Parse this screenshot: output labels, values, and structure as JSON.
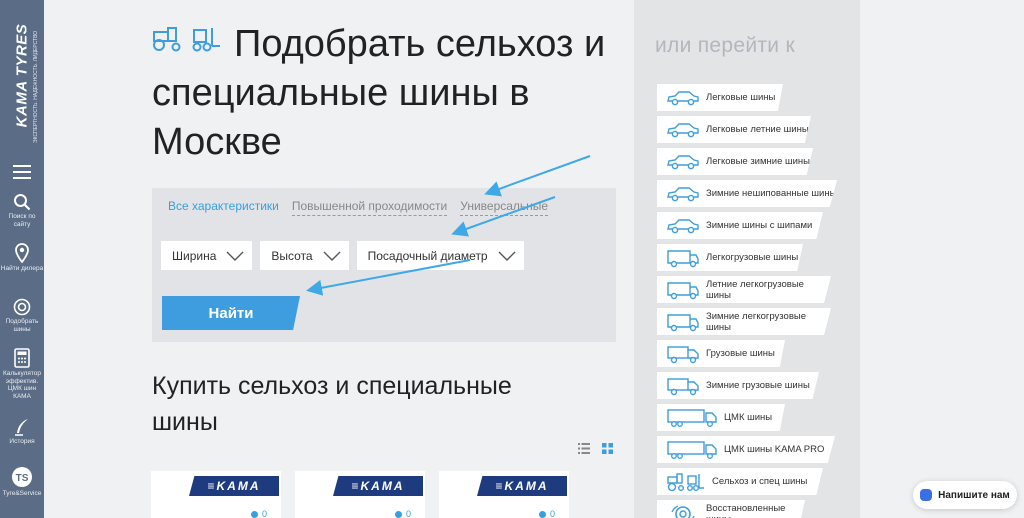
{
  "sidebar": {
    "brand": "KAMA TYRES",
    "brand_tagline": "ЭКСПЕРТНОСТЬ. НАДЕЖНОСТЬ. ЛИДЕРСТВО",
    "items": [
      {
        "label": ""
      },
      {
        "label": "Поиск по сайту"
      },
      {
        "label": "Найти дилера"
      },
      {
        "label": "Подобрать шины"
      },
      {
        "label": "Калькулятор эффектив. ЦМК шин КАМА"
      },
      {
        "label": "История"
      },
      {
        "label": "Tyre&Service"
      }
    ]
  },
  "hero": {
    "title": "Подобрать сельхоз и специальные шины в Москве"
  },
  "filter": {
    "tabs": [
      "Все характеристики",
      "Повышенной проходимости",
      "Универсальные"
    ],
    "selects": [
      "Ширина",
      "Высота",
      "Посадочный диаметр"
    ],
    "find_button": "Найти"
  },
  "catalog": {
    "title": "Купить сельхоз и специальные шины",
    "cards": [
      {
        "brand": "≡KAMA",
        "likes": "0"
      },
      {
        "brand": "≡KAMA",
        "likes": "0"
      },
      {
        "brand": "≡KAMA",
        "likes": "0"
      }
    ]
  },
  "right_panel": {
    "title": "или перейти к",
    "categories": [
      {
        "label": "Легковые шины",
        "icon": "car-icon"
      },
      {
        "label": "Легковые летние шины",
        "icon": "car-icon"
      },
      {
        "label": "Легковые зимние шины",
        "icon": "car-icon"
      },
      {
        "label": "Зимние нешипованные шины",
        "icon": "car-icon"
      },
      {
        "label": "Зимние шины с шипами",
        "icon": "car-icon"
      },
      {
        "label": "Легкогрузовые шины",
        "icon": "van-icon"
      },
      {
        "label": "Летние легкогрузовые шины",
        "icon": "van-icon"
      },
      {
        "label": "Зимние легкогрузовые шины",
        "icon": "van-icon"
      },
      {
        "label": "Грузовые шины",
        "icon": "truck-icon"
      },
      {
        "label": "Зимние грузовые шины",
        "icon": "truck-icon"
      },
      {
        "label": "ЦМК шины",
        "icon": "lorry-icon"
      },
      {
        "label": "ЦМК шины KAMA PRO",
        "icon": "lorry-icon"
      },
      {
        "label": "Сельхоз и спец шины",
        "icon": "tractor-icon"
      },
      {
        "label": "Восстановленные шины",
        "icon": "tire-recycle-icon"
      }
    ]
  },
  "chat": {
    "label": "Напишите нам"
  },
  "colors": {
    "sidebar": "#5b6d86",
    "accent": "#3d9dde",
    "brand_navy": "#1d3b7e"
  }
}
